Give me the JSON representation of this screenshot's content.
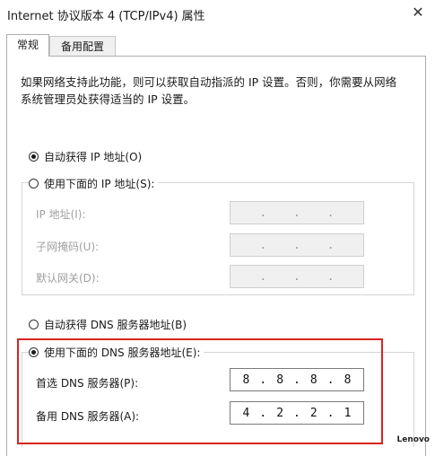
{
  "window": {
    "title": "Internet 协议版本 4 (TCP/IPv4) 属性",
    "close_glyph": "✕"
  },
  "tabs": [
    {
      "label": "常规"
    },
    {
      "label": "备用配置"
    }
  ],
  "description": "如果网络支持此功能，则可以获取自动指派的 IP 设置。否则，你需要从网络系统管理员处获得适当的 IP 设置。",
  "ip": {
    "auto_label": "自动获得 IP 地址(O)",
    "manual_label": "使用下面的 IP 地址(S):",
    "selected": "auto",
    "fields": [
      {
        "label": "IP 地址(I):",
        "octets": [
          "",
          "",
          "",
          ""
        ]
      },
      {
        "label": "子网掩码(U):",
        "octets": [
          "",
          "",
          "",
          ""
        ]
      },
      {
        "label": "默认网关(D):",
        "octets": [
          "",
          "",
          "",
          ""
        ]
      }
    ]
  },
  "dns": {
    "auto_label": "自动获得 DNS 服务器地址(B)",
    "manual_label": "使用下面的 DNS 服务器地址(E):",
    "selected": "manual",
    "preferred": {
      "label": "首选 DNS 服务器(P):",
      "octets": [
        "8",
        "8",
        "8",
        "8"
      ]
    },
    "alternate": {
      "label": "备用 DNS 服务器(A):",
      "octets": [
        "4",
        "2",
        "2",
        "1"
      ]
    }
  },
  "watermark": "Lenovo",
  "colors": {
    "highlight": "#d9231f",
    "disabled_text": "#a0a0a0"
  }
}
